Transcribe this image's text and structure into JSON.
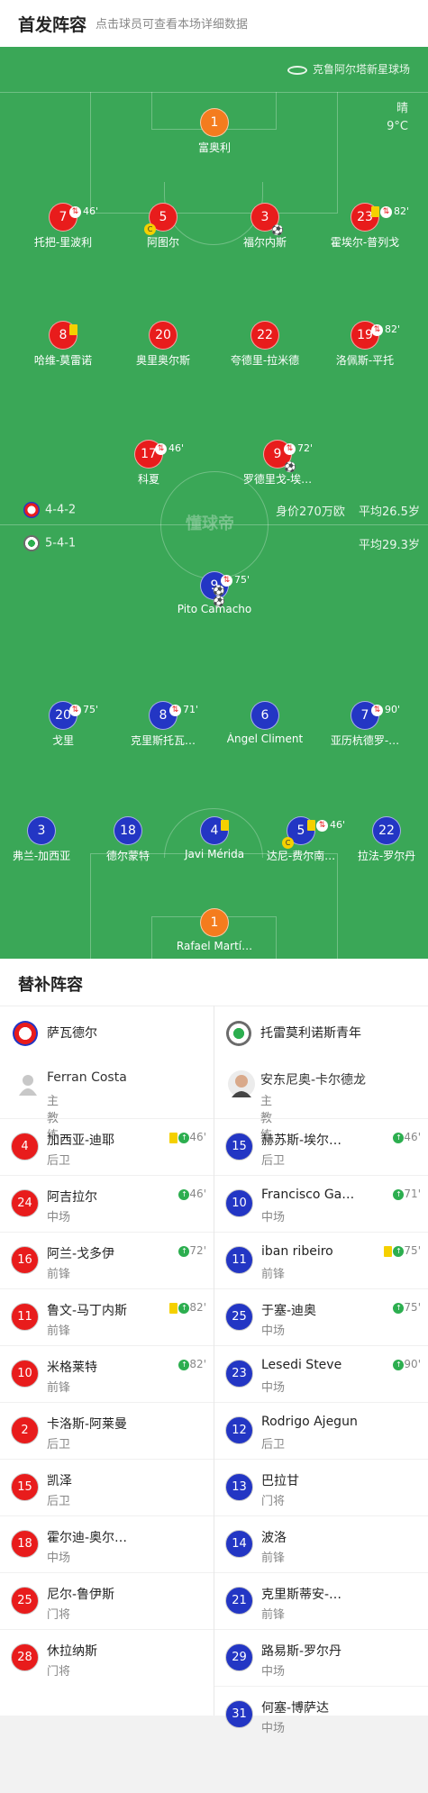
{
  "header": {
    "title": "首发阵容",
    "subtitle": "点击球员可查看本场详细数据"
  },
  "pitch": {
    "stadium": "克鲁阿尔塔新星球场",
    "weather": "晴",
    "temperature": "9°C",
    "watermark": "懂球帝"
  },
  "teams": {
    "home": {
      "formation": "4-4-2",
      "value": "身价270万欧",
      "avg_age": "平均26.5岁"
    },
    "away": {
      "formation": "5-4-1",
      "avg_age": "平均29.3岁"
    }
  },
  "home_players": [
    {
      "num": "1",
      "name": "富奥利",
      "gk": true,
      "events": ""
    },
    {
      "num": "7",
      "name": "托把-里波利",
      "events": "46'",
      "sub": true
    },
    {
      "num": "5",
      "name": "阿图尔",
      "events": "",
      "cap": true
    },
    {
      "num": "3",
      "name": "福尔内斯",
      "events": "",
      "ball": true
    },
    {
      "num": "23",
      "name": "霍埃尔-普列戈",
      "events": "82'",
      "yc": true,
      "sub": true
    },
    {
      "num": "8",
      "name": "哈维-莫雷诺",
      "events": "",
      "yc": true
    },
    {
      "num": "20",
      "name": "奥里奥尔斯",
      "events": ""
    },
    {
      "num": "22",
      "name": "夸德里-拉米德",
      "events": ""
    },
    {
      "num": "19",
      "name": "洛佩斯-平托",
      "events": "82'",
      "sub": true
    },
    {
      "num": "17",
      "name": "科夏",
      "events": "46'",
      "sub": true
    },
    {
      "num": "9",
      "name": "罗德里戈-埃…",
      "events": "72'",
      "sub": true,
      "ball": true
    }
  ],
  "away_players": [
    {
      "num": "9",
      "name": "Pito Camacho",
      "events": "75'",
      "sub": true,
      "balls": "⚽⚽"
    },
    {
      "num": "20",
      "name": "戈里",
      "events": "75'",
      "sub": true
    },
    {
      "num": "8",
      "name": "克里斯托瓦…",
      "events": "71'",
      "sub": true
    },
    {
      "num": "6",
      "name": "Ángel Climent",
      "events": ""
    },
    {
      "num": "7",
      "name": "亚历杭德罗-…",
      "events": "90'",
      "sub": true
    },
    {
      "num": "3",
      "name": "弗兰-加西亚",
      "events": ""
    },
    {
      "num": "18",
      "name": "德尔蒙特",
      "events": ""
    },
    {
      "num": "4",
      "name": "Javi Mérida",
      "events": "",
      "yc": true
    },
    {
      "num": "5",
      "name": "达尼-费尔南…",
      "events": "46'",
      "yc": true,
      "sub": true,
      "cap": true
    },
    {
      "num": "22",
      "name": "拉法-罗尔丹",
      "events": ""
    },
    {
      "num": "1",
      "name": "Rafael Martí…",
      "gk": true,
      "events": ""
    }
  ],
  "bench": {
    "title": "替补阵容",
    "home_team": "萨瓦德尔",
    "away_team": "托雷莫利诺斯青年",
    "home_coach": {
      "name": "Ferran Costa",
      "role": "主教练"
    },
    "away_coach": {
      "name": "安东尼奥-卡尔德龙",
      "role": "主教练"
    },
    "home": [
      {
        "num": "4",
        "name": "加西亚-迪耶",
        "pos": "后卫",
        "yc": true,
        "ev": "46'"
      },
      {
        "num": "24",
        "name": "阿吉拉尔",
        "pos": "中场",
        "ev": "46'"
      },
      {
        "num": "16",
        "name": "阿兰-戈多伊",
        "pos": "前锋",
        "ev": "72'"
      },
      {
        "num": "11",
        "name": "鲁文-马丁内斯",
        "pos": "前锋",
        "yc": true,
        "ev": "82'"
      },
      {
        "num": "10",
        "name": "米格莱特",
        "pos": "前锋",
        "ev": "82'"
      },
      {
        "num": "2",
        "name": "卡洛斯-阿莱曼",
        "pos": "后卫",
        "ev": ""
      },
      {
        "num": "15",
        "name": "凯泽",
        "pos": "后卫",
        "ev": ""
      },
      {
        "num": "18",
        "name": "霍尔迪-奥尔…",
        "pos": "中场",
        "ev": ""
      },
      {
        "num": "25",
        "name": "尼尔-鲁伊斯",
        "pos": "门将",
        "ev": ""
      },
      {
        "num": "28",
        "name": "休拉纳斯",
        "pos": "门将",
        "ev": ""
      }
    ],
    "away": [
      {
        "num": "15",
        "name": "赫苏斯-埃尔…",
        "pos": "后卫",
        "ev": "46'"
      },
      {
        "num": "10",
        "name": "Francisco Ga…",
        "pos": "中场",
        "ev": "71'"
      },
      {
        "num": "11",
        "name": "iban ribeiro",
        "pos": "前锋",
        "yc": true,
        "ev": "75'"
      },
      {
        "num": "25",
        "name": "于塞-迪奥",
        "pos": "中场",
        "ev": "75'"
      },
      {
        "num": "23",
        "name": "Lesedi Steve",
        "pos": "中场",
        "ev": "90'"
      },
      {
        "num": "12",
        "name": "Rodrigo Ajegun",
        "pos": "后卫",
        "ev": ""
      },
      {
        "num": "13",
        "name": "巴拉甘",
        "pos": "门将",
        "ev": ""
      },
      {
        "num": "14",
        "name": "波洛",
        "pos": "前锋",
        "ev": ""
      },
      {
        "num": "21",
        "name": "克里斯蒂安-…",
        "pos": "前锋",
        "ev": ""
      },
      {
        "num": "29",
        "name": "路易斯-罗尔丹",
        "pos": "中场",
        "ev": ""
      },
      {
        "num": "31",
        "name": "何塞-博萨达",
        "pos": "中场",
        "ev": ""
      }
    ]
  }
}
